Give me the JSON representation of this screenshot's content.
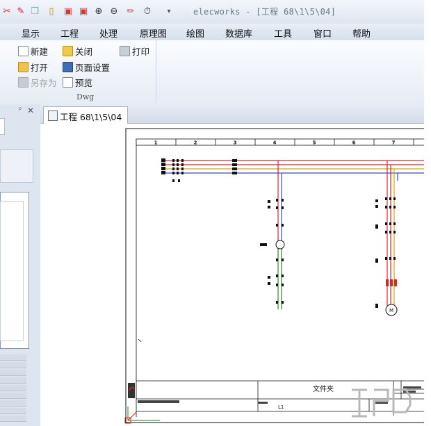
{
  "window": {
    "title": "elecworks - [工程 68\\1\\5\\04]"
  },
  "quick_access": {
    "icons": [
      "tool-icon",
      "copy-icon",
      "new-document-icon",
      "import-icon",
      "export-icon",
      "zoom-in-icon",
      "zoom-out-icon",
      "pencil-icon",
      "timer-icon"
    ],
    "dropdown": "▾"
  },
  "menu": [
    "显示",
    "工程",
    "处理",
    "原理图",
    "绘图",
    "数据库",
    "工具",
    "窗口",
    "帮助"
  ],
  "ribbon": {
    "group_label": "Dwg",
    "buttons": {
      "new": "新建",
      "close": "关闭",
      "print": "打印",
      "open": "打开",
      "page_setup": "页面设置",
      "save_as": "另存为",
      "preview": "预览"
    }
  },
  "left_panel": {
    "pin": "ᵖ",
    "close": "✕"
  },
  "document_tab": {
    "label": "工程 68\\1\\5\\04"
  },
  "drawing": {
    "columns": [
      "1",
      "2",
      "3",
      "4",
      "5",
      "6",
      "7"
    ],
    "title_block": {
      "center_text": "文件夹",
      "field_l1": "L1"
    }
  },
  "colors": {
    "accent": "#2d5ea8",
    "wire_red": "#d8262a",
    "wire_blue": "#2d4fd0",
    "wire_orange": "#e0a000",
    "wire_green": "#3aa63a"
  }
}
